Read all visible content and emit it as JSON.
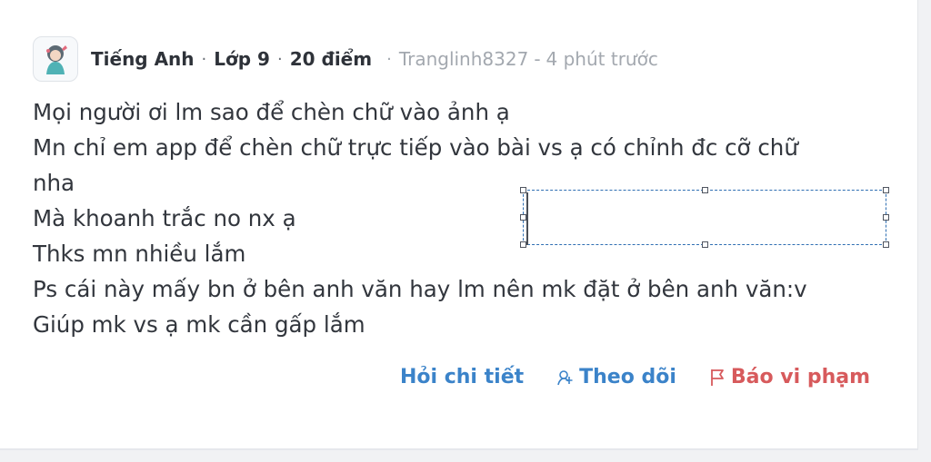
{
  "question": {
    "subject": "Tiếng Anh",
    "grade": "Lớp 9",
    "points": "20 điểm",
    "author": "Tranglinh8327",
    "time": "4 phút trước",
    "separator": "·",
    "time_separator": "-",
    "body_lines": [
      "Mọi người ơi lm sao để chèn chữ vào ảnh ạ",
      "Mn chỉ em app để chèn chữ trực tiếp vào bài vs ạ có chỉnh đc cỡ chữ",
      "nha",
      "Mà khoanh trắc no nx ạ",
      "Thks mn nhiều lắm",
      "Ps cái này mấy bn ở bên anh văn hay lm nên mk đặt ở bên anh văn:v",
      "Giúp mk vs ạ mk cần gấp lắm"
    ]
  },
  "actions": {
    "ask_detail": "Hỏi chi tiết",
    "follow": "Theo dõi",
    "report": "Báo vi phạm"
  },
  "icons": {
    "avatar": "subject-avatar-icon",
    "follow": "follow-icon",
    "report": "flag-icon"
  },
  "colors": {
    "action_blue": "#3b83c9",
    "action_red": "#d75a5c",
    "meta_light": "#a3a8af",
    "selection_border": "#2f6fb3"
  }
}
